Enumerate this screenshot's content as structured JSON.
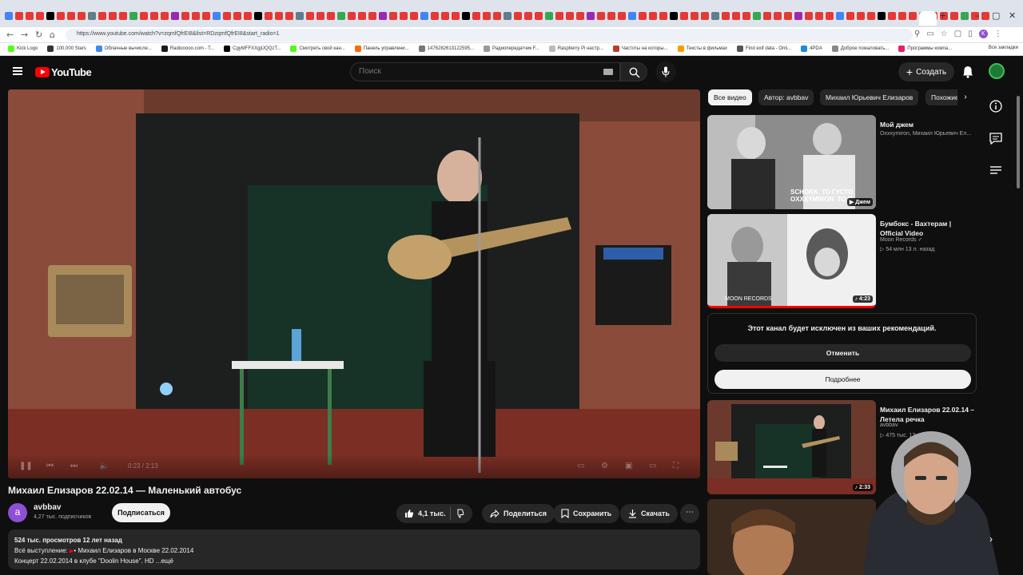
{
  "browser": {
    "url": "https://www.youtube.com/watch?v=zqmfQfrEI8&list=RDzqmfQfrEI8&start_radio=1",
    "window_controls": [
      "–",
      "▢",
      "✕"
    ],
    "new_tab": "+",
    "bookmarks": [
      {
        "label": "Kick Logo",
        "color": "#53fc18"
      },
      {
        "label": "100,000 Stars",
        "color": "#333333"
      },
      {
        "label": "Облачные вычисле...",
        "color": "#4285f4"
      },
      {
        "label": "Radiooooo.com - T...",
        "color": "#1a1a1a"
      },
      {
        "label": "CgyMFFXXgjlJQQzT...",
        "color": "#000000"
      },
      {
        "label": "Смотреть свой кан...",
        "color": "#53fc18"
      },
      {
        "label": "Панель управлени...",
        "color": "#ff6a00"
      },
      {
        "label": "1476282613122595...",
        "color": "#777777"
      },
      {
        "label": "Радиопередатчик F...",
        "color": "#999999"
      },
      {
        "label": "Raspberry Pi настр...",
        "color": "#bbbbbb"
      },
      {
        "label": "Частоты на которы...",
        "color": "#c0392b"
      },
      {
        "label": "Тексты в фильмах",
        "color": "#ff9800"
      },
      {
        "label": "Find exif data - Onli...",
        "color": "#555555"
      },
      {
        "label": "4PDA",
        "color": "#1e88e5"
      },
      {
        "label": "Доброе пожаловать...",
        "color": "#888888"
      },
      {
        "label": "Программы компа...",
        "color": "#e91e63"
      }
    ],
    "all_bookmarks": "Все закладки"
  },
  "header": {
    "logo_text": "YouTube",
    "search_placeholder": "Поиск",
    "create_label": "Создать"
  },
  "player": {
    "time": "0:23 / 2:13"
  },
  "video": {
    "title": "Михаил Елизаров 22.02.14 — Маленький автобус",
    "channel": "avbbav",
    "channel_initial": "a",
    "subscribers": "4,27 тыс. подписчиков",
    "subscribe_label": "Подписаться",
    "likes": "4,1 тыс.",
    "share_label": "Поделиться",
    "save_label": "Сохранить",
    "download_label": "Скачать",
    "views_date": "524 тыс. просмотров  12 лет назад",
    "desc_line2_prefix": "Всё выступление: ",
    "desc_line2_link": "• Михаил Елизаров в Москве 22.02.2014",
    "desc_line3": "Концерт 22.02.2014 в клубе \"Doolin House\". HD ...ещё"
  },
  "chips": [
    "Все видео",
    "Автор: avbbav",
    "Михаил Юрьевич Елизаров",
    "Похожие"
  ],
  "recommendations": [
    {
      "title": "Мой джем",
      "meta1": "Oxxxymiron, Михаил Юрьевич Ел...",
      "meta2": "",
      "duration": "▶ Джем",
      "overlay": "SCHOKK  ТО ГУСТО\nOXXXYMIRON  ТО П"
    },
    {
      "title": "Бумбокс - Вахтерам | Official Video",
      "meta1": "Moon Records ✓",
      "meta2": "▷ 54 млн  13 л. назад",
      "duration": "♪ 4:23",
      "overlay": "MOON RECORDS"
    },
    {
      "title": "Михаил Елизаров 22.02.14 – Летела речка",
      "meta1": "avbbav",
      "meta2": "▷ 475 тыс.  12",
      "duration": "♪ 2:33",
      "overlay": ""
    }
  ],
  "removed_card": {
    "message": "Этот канал будет исключен из ваших рекомендаций.",
    "undo_label": "Отменить",
    "more_label": "Подробнее"
  },
  "colors": {
    "accent_red": "#ff0000",
    "bg": "#0f0f0f",
    "surface": "#272727"
  }
}
